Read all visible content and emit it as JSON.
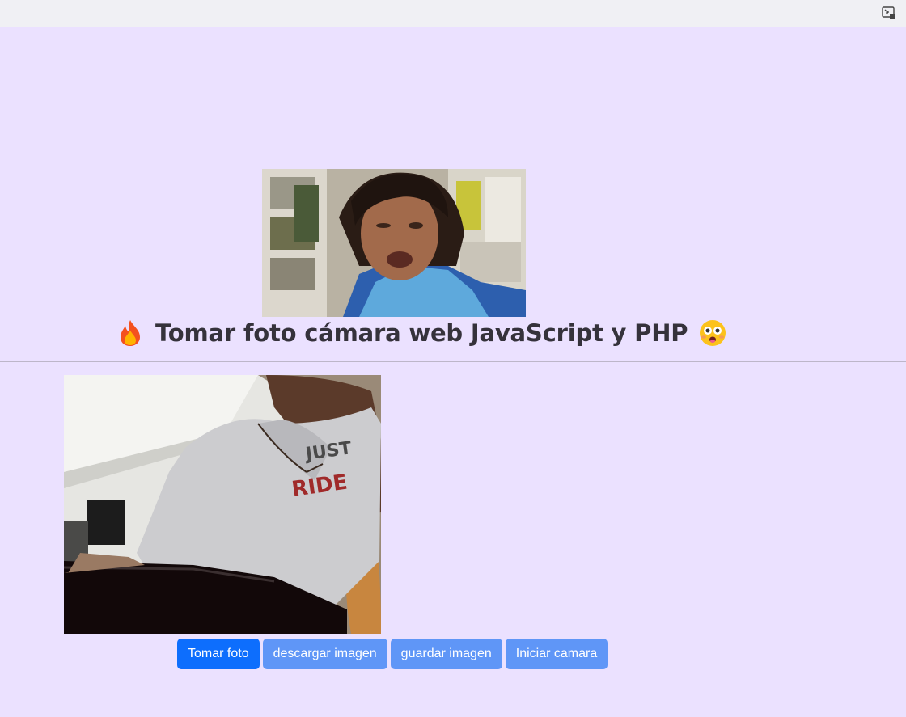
{
  "browser": {
    "pip_icon": "picture-in-picture-icon"
  },
  "hero": {
    "image": "animated-gif-man-grimacing"
  },
  "heading": {
    "title": "Tomar foto cámara web JavaScript y PHP",
    "leading_icon": "fire-emoji",
    "trailing_icon": "flushed-face-emoji"
  },
  "camera": {
    "feed": "webcam-video-feed"
  },
  "buttons": {
    "take_photo": "Tomar foto",
    "download_image": "descargar imagen",
    "save_image": "guardar imagen",
    "start_camera": "Iniciar camara"
  },
  "colors": {
    "background": "#ebe1ff",
    "primary": "#0d6efd",
    "secondary_button": "#5f96f7"
  }
}
